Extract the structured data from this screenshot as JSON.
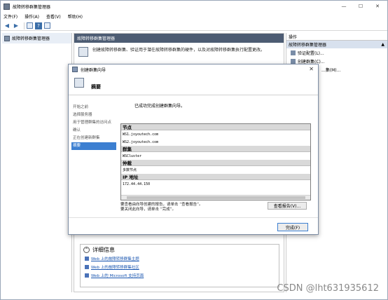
{
  "window": {
    "title": "故障转移群集管理器"
  },
  "menu": [
    "文件(F)",
    "操作(A)",
    "查看(V)",
    "帮助(H)"
  ],
  "tree": {
    "root_label": "故障转移群集管理器"
  },
  "center": {
    "header": "故障转移群集管理器",
    "intro_text": "创建故障转移群集、验证用于潜在故障转移群集的硬件，以及对故障转移群集执行配置更改。"
  },
  "details": {
    "heading": "详细信息",
    "links": [
      "Web 上的故障转移群集主题",
      "Web 上的故障转移群集社区",
      "Web 上的 Microsoft 支持页面"
    ]
  },
  "actions": {
    "header": "操作",
    "sub_header": "故障转移群集管理器",
    "items": [
      "验证配置(L)...",
      "创建群集(C)...",
      "...集(M)..."
    ]
  },
  "dialog": {
    "title": "创建群集向导",
    "header_title": "摘要",
    "nav": [
      "开始之前",
      "选择服务器",
      "用于管理群集的访问点",
      "确认",
      "正在创建新群集",
      "摘要"
    ],
    "success": "已成功完成创建群集向导。",
    "summary": {
      "nodes_label": "节点",
      "nodes": [
        "WS1.joyoutech.com",
        "WS2.joyoutech.com"
      ],
      "cluster_label": "群集",
      "cluster": "WSCluster",
      "quorum_label": "仲裁",
      "quorum": "多数节点",
      "ip_label": "IP 地址",
      "ip": "172.44.44.150"
    },
    "notice_line1": "要查看由向导创建的报告，请单击 “查看报告”。",
    "notice_line2": "要关闭此向导，请单击 “完成”。",
    "view_report": "查看报告(V)...",
    "finish": "完成(F)"
  },
  "watermark": "CSDN @lht631935612"
}
